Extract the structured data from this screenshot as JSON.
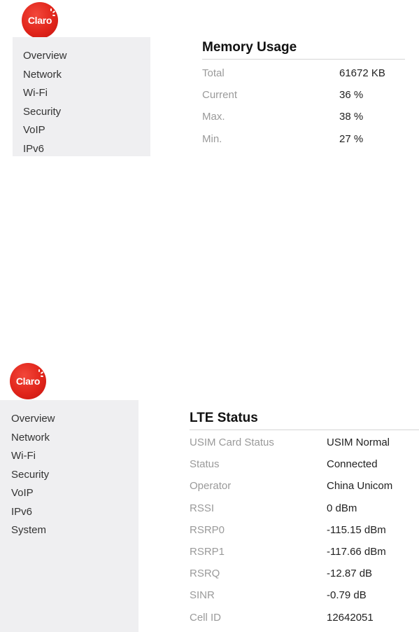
{
  "brand": {
    "logo_text": "Claro",
    "accent": "#e1251b"
  },
  "top_panel": {
    "sidebar": {
      "items": [
        {
          "label": "Overview"
        },
        {
          "label": "Network"
        },
        {
          "label": "Wi-Fi"
        },
        {
          "label": "Security"
        },
        {
          "label": "VoIP"
        },
        {
          "label": "IPv6"
        }
      ]
    },
    "memory": {
      "title": "Memory Usage",
      "rows": [
        {
          "label": "Total",
          "value": "61672 KB"
        },
        {
          "label": "Current",
          "value": "36 %"
        },
        {
          "label": "Max.",
          "value": "38 %"
        },
        {
          "label": "Min.",
          "value": "27 %"
        }
      ]
    }
  },
  "bottom_panel": {
    "sidebar": {
      "items": [
        {
          "label": "Overview"
        },
        {
          "label": "Network"
        },
        {
          "label": "Wi-Fi"
        },
        {
          "label": "Security"
        },
        {
          "label": "VoIP"
        },
        {
          "label": "IPv6"
        },
        {
          "label": "System"
        }
      ]
    },
    "lte": {
      "title": "LTE Status",
      "rows": [
        {
          "label": "USIM Card Status",
          "value": "USIM Normal"
        },
        {
          "label": "Status",
          "value": "Connected"
        },
        {
          "label": "Operator",
          "value": "China Unicom"
        },
        {
          "label": "RSSI",
          "value": "0 dBm"
        },
        {
          "label": "RSRP0",
          "value": "-115.15 dBm"
        },
        {
          "label": "RSRP1",
          "value": "-117.66 dBm"
        },
        {
          "label": "RSRQ",
          "value": "-12.87 dB"
        },
        {
          "label": "SINR",
          "value": "-0.79 dB"
        },
        {
          "label": "Cell ID",
          "value": "12642051"
        }
      ]
    }
  }
}
